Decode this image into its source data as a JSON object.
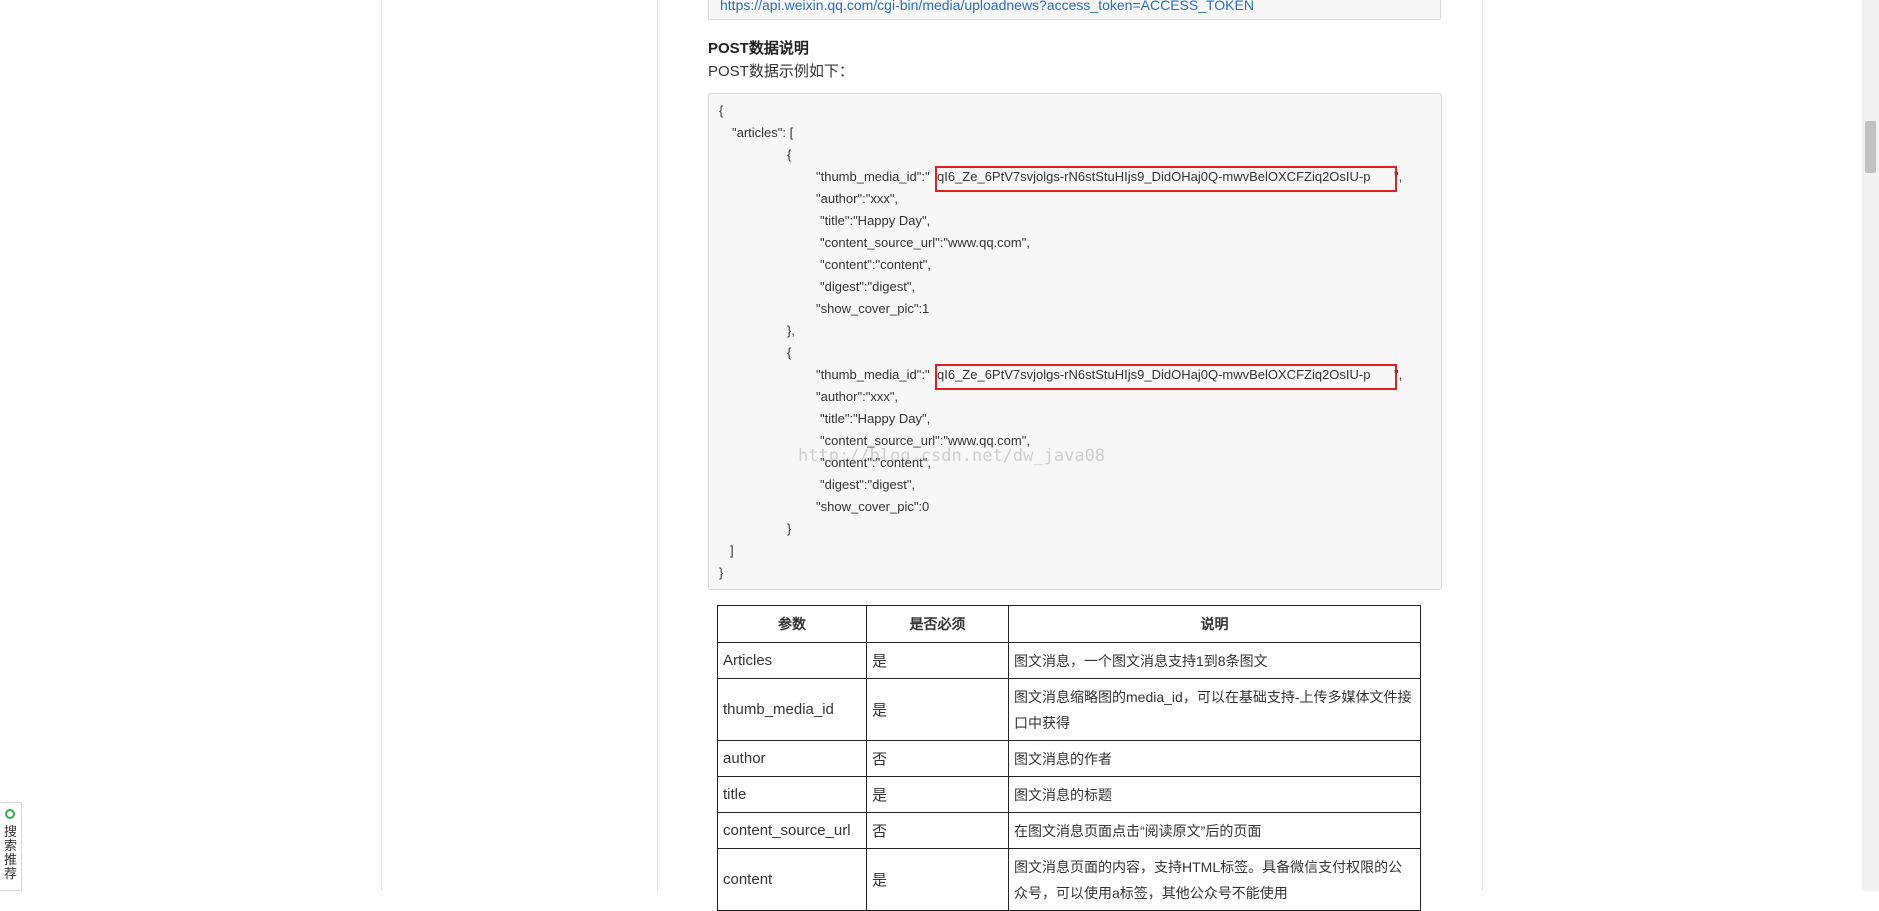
{
  "api_url": "https://api.weixin.qq.com/cgi-bin/media/uploadnews?access_token=ACCESS_TOKEN",
  "post_heading": "POST数据说明",
  "post_sub": "POST数据示例如下：",
  "code": {
    "l1": "{",
    "l2": "\"articles\": [",
    "l3": "{",
    "l4_key": "\"thumb_media_id\":\"",
    "l4_val": "qI6_Ze_6PtV7svjolgs-rN6stStuHIjs9_DidOHaj0Q-mwvBelOXCFZiq2OsIU-p",
    "l4_end": "\",",
    "l5": "\"author\":\"xxx\",",
    "l6": "\"title\":\"Happy Day\",",
    "l7": "\"content_source_url\":\"www.qq.com\",",
    "l8": "\"content\":\"content\",",
    "l9": "\"digest\":\"digest\",",
    "l10": "\"show_cover_pic\":1",
    "l11": "},",
    "l12": "{",
    "l13_key": "\"thumb_media_id\":\"",
    "l13_val": "qI6_Ze_6PtV7svjolgs-rN6stStuHIjs9_DidOHaj0Q-mwvBelOXCFZiq2OsIU-p",
    "l13_end": "\",",
    "l14": "\"author\":\"xxx\",",
    "l15": "\"title\":\"Happy Day\",",
    "l16": "\"content_source_url\":\"www.qq.com\",",
    "l17": "\"content\":\"content\",",
    "l18": "\"digest\":\"digest\",",
    "l19": "\"show_cover_pic\":0",
    "l20": "}",
    "l21": "]",
    "l22": "}"
  },
  "watermark": "http://blog.csdn.net/dw_java08",
  "table": {
    "headers": [
      "参数",
      "是否必须",
      "说明"
    ],
    "rows": [
      {
        "param": "Articles",
        "required": "是",
        "desc": "图文消息，一个图文消息支持1到8条图文"
      },
      {
        "param": "thumb_media_id",
        "required": "是",
        "desc": "图文消息缩略图的media_id，可以在基础支持-上传多媒体文件接口中获得"
      },
      {
        "param": "author",
        "required": "否",
        "desc": "图文消息的作者"
      },
      {
        "param": "title",
        "required": "是",
        "desc": "图文消息的标题"
      },
      {
        "param": "content_source_url",
        "required": "否",
        "desc": "在图文消息页面点击“阅读原文”后的页面"
      },
      {
        "param": "content",
        "required": "是",
        "desc": "图文消息页面的内容，支持HTML标签。具备微信支付权限的公众号，可以使用a标签，其他公众号不能使用"
      }
    ]
  },
  "side_widget": {
    "text": "搜索推荐",
    "icon": "search-icon"
  }
}
